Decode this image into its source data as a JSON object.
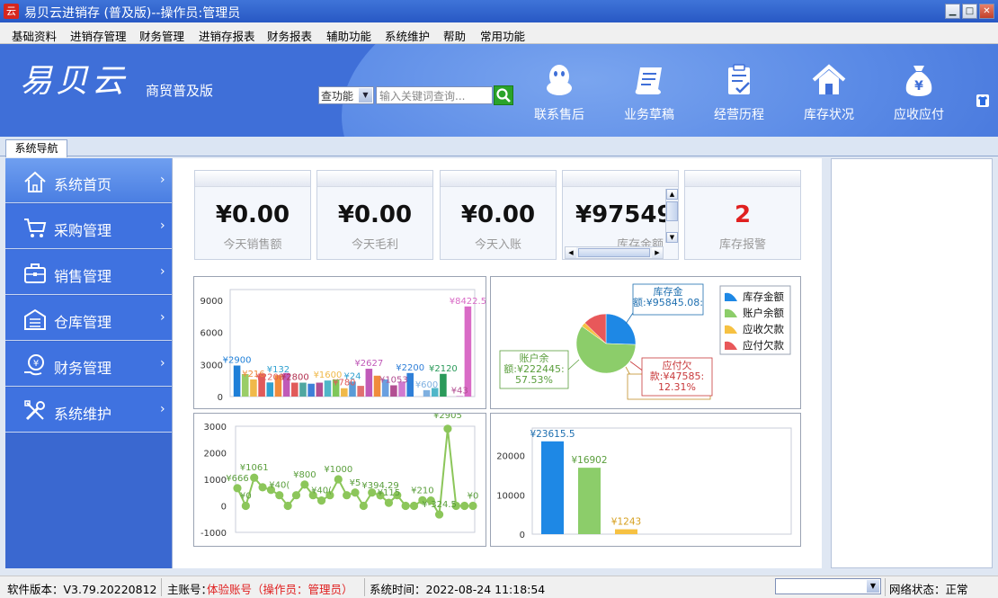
{
  "window": {
    "title": "易贝云进销存 (普及版)--操作员:管理员",
    "app_icon": "云",
    "min": "▁",
    "max": "□",
    "close": "✕"
  },
  "menu": [
    "基础资料",
    "进销存管理",
    "财务管理",
    "进销存报表",
    "财务报表",
    "辅助功能",
    "系统维护",
    "帮助",
    "常用功能"
  ],
  "banner": {
    "logo": "易贝云",
    "subtitle": "商贸普及版",
    "search_select": "查功能",
    "search_placeholder": "输入关键词查询...",
    "shortcuts": [
      {
        "label": "联系售后",
        "icon": "qq-penguin-icon"
      },
      {
        "label": "业务草稿",
        "icon": "draft-scroll-icon"
      },
      {
        "label": "经营历程",
        "icon": "clipboard-check-icon"
      },
      {
        "label": "库存状况",
        "icon": "house-icon"
      },
      {
        "label": "应收应付",
        "icon": "money-bag-icon"
      }
    ]
  },
  "tab": "系统导航",
  "sidebar": [
    {
      "label": "系统首页",
      "icon": "home-icon",
      "chev": "›"
    },
    {
      "label": "采购管理",
      "icon": "cart-icon",
      "chev": "›"
    },
    {
      "label": "销售管理",
      "icon": "briefcase-icon",
      "chev": "›"
    },
    {
      "label": "仓库管理",
      "icon": "warehouse-icon",
      "chev": "›"
    },
    {
      "label": "财务管理",
      "icon": "coin-hand-icon",
      "chev": "›"
    },
    {
      "label": "系统维护",
      "icon": "tools-icon",
      "chev": "›"
    }
  ],
  "cards": [
    {
      "value": "¥0.00",
      "caption": "今天销售额",
      "color": "#111111"
    },
    {
      "value": "¥0.00",
      "caption": "今天毛利",
      "color": "#111111"
    },
    {
      "value": "¥0.00",
      "caption": "今天入账",
      "color": "#111111"
    },
    {
      "value": "¥97549",
      "caption": "库存金额",
      "color": "#111111"
    },
    {
      "value": "2",
      "caption": "库存报警",
      "color": "#e02020"
    }
  ],
  "chart_data": [
    {
      "type": "bar",
      "ylim": [
        0,
        10000
      ],
      "yticks": [
        "9000",
        "6000",
        "3000",
        "0"
      ],
      "values": [
        2900,
        2100,
        1600,
        2150,
        1320,
        2000,
        2200,
        1300,
        1300,
        1200,
        1300,
        1500,
        1600,
        780,
        1400,
        1000,
        2600,
        1950,
        1600,
        1053,
        1400,
        2200,
        0,
        600,
        800,
        2120,
        0,
        43,
        8422.5
      ],
      "colors": [
        "#1e7fd8",
        "#9acd67",
        "#f0b94a",
        "#e15a5a",
        "#2fa0d0",
        "#f08c3c",
        "#c05ab8",
        "#e15a5a",
        "#4fa7a0",
        "#3e7fd8",
        "#b24f92",
        "#50b6c8",
        "#7fc75a",
        "#f0b94a",
        "#5a9bd6",
        "#e07070",
        "#c05ab8",
        "#f08c3c",
        "#6aa0e0",
        "#b24f92",
        "#d07ad0",
        "#2f7fd8",
        "#ffffff",
        "#7fb0e0",
        "#50b6c8",
        "#2a9a5a",
        "#ffffff",
        "#c05ab8",
        "#d96bc6"
      ],
      "labels": [
        {
          "i": 0,
          "text": "¥2900",
          "color": "#1e7fd8"
        },
        {
          "i": 2,
          "text": "¥216",
          "color": "#f08c3c"
        },
        {
          "i": 4,
          "text": "¥2200",
          "color": "#e15a5a"
        },
        {
          "i": 5,
          "text": "¥132",
          "color": "#2fa0d0"
        },
        {
          "i": 7,
          "text": "¥2800",
          "color": "#b23050"
        },
        {
          "i": 11,
          "text": "¥1600",
          "color": "#f0b94a"
        },
        {
          "i": 13,
          "text": "¥780",
          "color": "#e15a5a"
        },
        {
          "i": 14,
          "text": "¥24",
          "color": "#2fa0d0"
        },
        {
          "i": 16,
          "text": "¥2627",
          "color": "#c05ab8"
        },
        {
          "i": 19,
          "text": "¥1053",
          "color": "#b24f92"
        },
        {
          "i": 21,
          "text": "¥2200",
          "color": "#2f7fd8"
        },
        {
          "i": 23,
          "text": "¥600",
          "color": "#7fb0e0"
        },
        {
          "i": 25,
          "text": "¥2120",
          "color": "#2a9a5a"
        },
        {
          "i": 27,
          "text": "¥43",
          "color": "#b24f92"
        },
        {
          "i": 28,
          "text": "¥8422.5",
          "color": "#d96bc6"
        }
      ]
    },
    {
      "type": "pie",
      "legend": [
        {
          "name": "库存金额",
          "color": "#1e88e5"
        },
        {
          "name": "账户余额",
          "color": "#8ccd6a"
        },
        {
          "name": "应收欠款",
          "color": "#f6c142"
        },
        {
          "name": "应付欠款",
          "color": "#e8585a"
        }
      ],
      "values": [
        95845.08,
        222445,
        9000,
        47585
      ],
      "callouts": [
        {
          "lines": [
            "库存金",
            "额:¥95845.08:"
          ],
          "color": "#1e6fb0"
        },
        {
          "lines": [
            "账户余",
            "额:¥222445:",
            "57.53%"
          ],
          "color": "#5a9e3c"
        },
        {
          "lines": [
            "应付欠",
            "款:¥47585:",
            "12.31%"
          ],
          "color": "#c8393b"
        },
        {
          "lines": [
            "款"
          ],
          "color": "#c0902a"
        }
      ]
    },
    {
      "type": "line",
      "ylim": [
        -1000,
        3000
      ],
      "yticks": [
        "3000",
        "2000",
        "1000",
        "0",
        "-1000"
      ],
      "values": [
        666,
        0,
        1061,
        700,
        600,
        400,
        0,
        400,
        800,
        400,
        200,
        400,
        1000,
        400,
        500,
        0,
        500,
        394.29,
        115,
        400,
        0,
        0,
        210,
        200,
        -324.5,
        2905,
        0,
        0,
        0
      ],
      "labels": [
        {
          "i": 0,
          "text": "¥666"
        },
        {
          "i": 1,
          "text": "¥0"
        },
        {
          "i": 2,
          "text": "¥1061"
        },
        {
          "i": 5,
          "text": "¥40("
        },
        {
          "i": 8,
          "text": "¥800"
        },
        {
          "i": 10,
          "text": "¥40("
        },
        {
          "i": 12,
          "text": "¥1000"
        },
        {
          "i": 14,
          "text": "¥5"
        },
        {
          "i": 17,
          "text": "¥394.29"
        },
        {
          "i": 18,
          "text": "¥115"
        },
        {
          "i": 22,
          "text": "¥210"
        },
        {
          "i": 24,
          "text": "¥-324.5"
        },
        {
          "i": 25,
          "text": "¥2905"
        },
        {
          "i": 28,
          "text": "¥0"
        }
      ],
      "color": "#8cc65a"
    },
    {
      "type": "bar",
      "ylim": [
        0,
        27000
      ],
      "yticks": [
        "20000",
        "10000",
        "0"
      ],
      "values": [
        23615.5,
        16902,
        1243
      ],
      "colors": [
        "#1e88e5",
        "#8ccd6a",
        "#f6c142"
      ],
      "labels": [
        "¥23615.5",
        "¥16902",
        "¥1243"
      ],
      "label_colors": [
        "#1e6fb0",
        "#5a9e3c",
        "#d6a020"
      ]
    }
  ],
  "status": {
    "version": "软件版本：V3.79.20220812",
    "account_label": "主账号：",
    "account_value": "体验账号（操作员：管理员）",
    "time": "系统时间：2022-08-24 11:18:54",
    "network": "网络状态：正常"
  }
}
